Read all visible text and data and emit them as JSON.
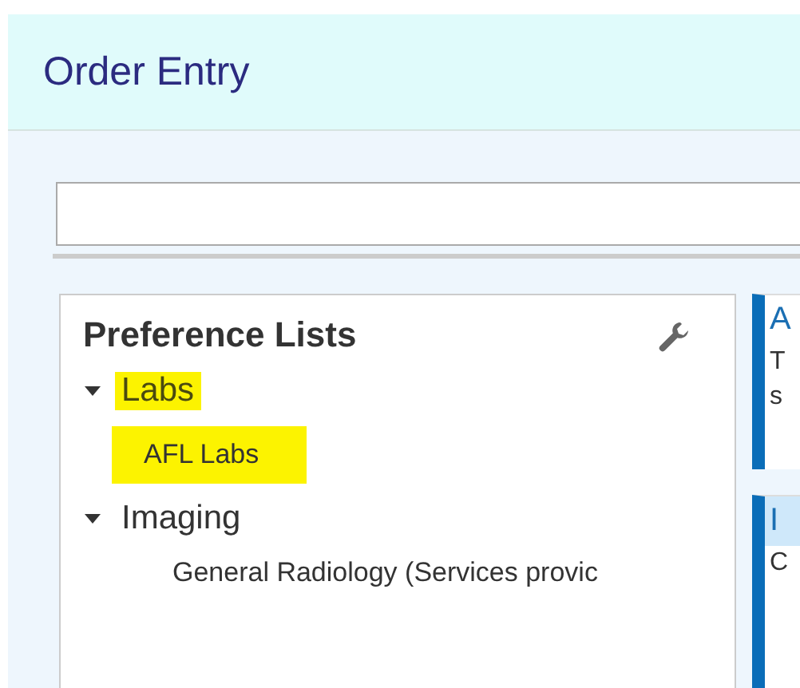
{
  "header": {
    "title": "Order Entry"
  },
  "preference_panel": {
    "title": "Preference Lists",
    "tree": [
      {
        "label": "Labs",
        "expanded": true,
        "highlighted": true,
        "children": [
          {
            "label": "AFL Labs",
            "highlighted": true
          }
        ]
      },
      {
        "label": "Imaging",
        "expanded": true,
        "highlighted": false,
        "children": [
          {
            "label": "General Radiology (Services provic",
            "highlighted": false
          }
        ]
      }
    ]
  },
  "side_cards": [
    {
      "title": "A",
      "title_highlighted": false,
      "lines": [
        "T",
        "s"
      ]
    },
    {
      "title": "I",
      "title_highlighted": true,
      "lines": [
        "C"
      ]
    }
  ]
}
